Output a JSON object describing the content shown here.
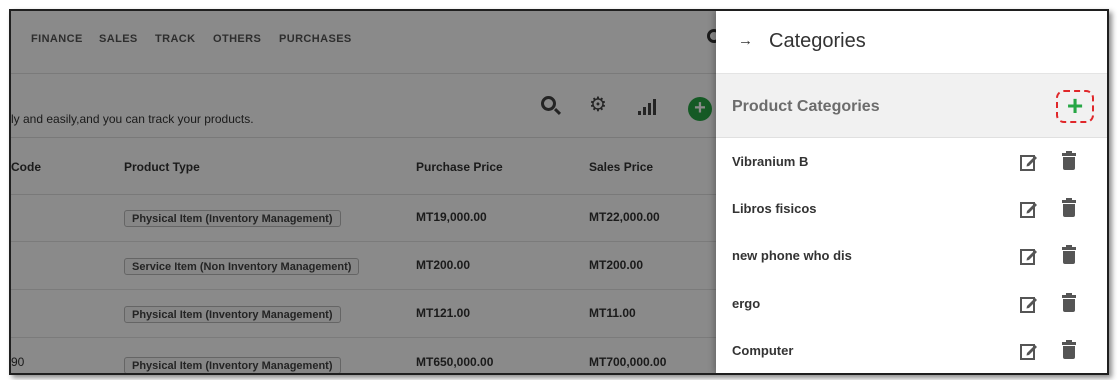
{
  "nav": {
    "items": [
      "FINANCE",
      "SALES",
      "TRACK",
      "OTHERS",
      "PURCHASES"
    ]
  },
  "page": {
    "description": "ly and easily,and you can track your products."
  },
  "table": {
    "headers": [
      "Code",
      "Product Type",
      "Purchase Price",
      "Sales Price"
    ],
    "rows": [
      {
        "code": "",
        "type": "Physical Item (Inventory Management)",
        "purchase": "MT19,000.00",
        "sales": "MT22,000.00"
      },
      {
        "code": "",
        "type": "Service Item (Non Inventory Management)",
        "purchase": "MT200.00",
        "sales": "MT200.00"
      },
      {
        "code": "",
        "type": "Physical Item (Inventory Management)",
        "purchase": "MT121.00",
        "sales": "MT11.00"
      },
      {
        "code": "90",
        "type": "Physical Item (Inventory Management)",
        "purchase": "MT650,000.00",
        "sales": "MT700,000.00"
      }
    ]
  },
  "panel": {
    "back_icon": "→",
    "title": "Categories",
    "section_title": "Product Categories",
    "add_icon": "+",
    "categories": [
      "Vibranium B",
      "Libros fisicos",
      "new phone who dis",
      "ergo",
      "Computer"
    ]
  },
  "colors": {
    "accent_green": "#27a745",
    "highlight_red": "#e0272a"
  }
}
